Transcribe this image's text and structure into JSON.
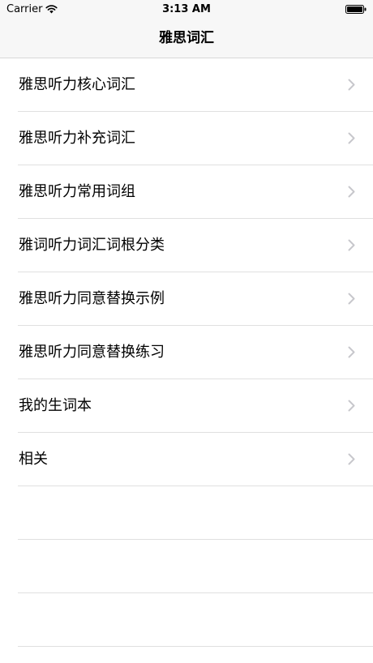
{
  "status_bar": {
    "carrier": "Carrier",
    "time": "3:13 AM",
    "wifi_icon": "wifi-icon",
    "battery_icon": "battery-icon"
  },
  "nav": {
    "title": "雅思词汇"
  },
  "menu": {
    "items": [
      {
        "label": "雅思听力核心词汇"
      },
      {
        "label": "雅思听力补充词汇"
      },
      {
        "label": "雅思听力常用词组"
      },
      {
        "label": "雅词听力词汇词根分类"
      },
      {
        "label": "雅思听力同意替换示例"
      },
      {
        "label": "雅思听力同意替换练习"
      },
      {
        "label": "我的生词本"
      },
      {
        "label": "相关"
      }
    ],
    "chevron_icon": "chevron-right-icon"
  },
  "colors": {
    "bar_background": "#f7f7f7",
    "separator": "#e0e0e0",
    "chevron": "#c7c7cc"
  }
}
